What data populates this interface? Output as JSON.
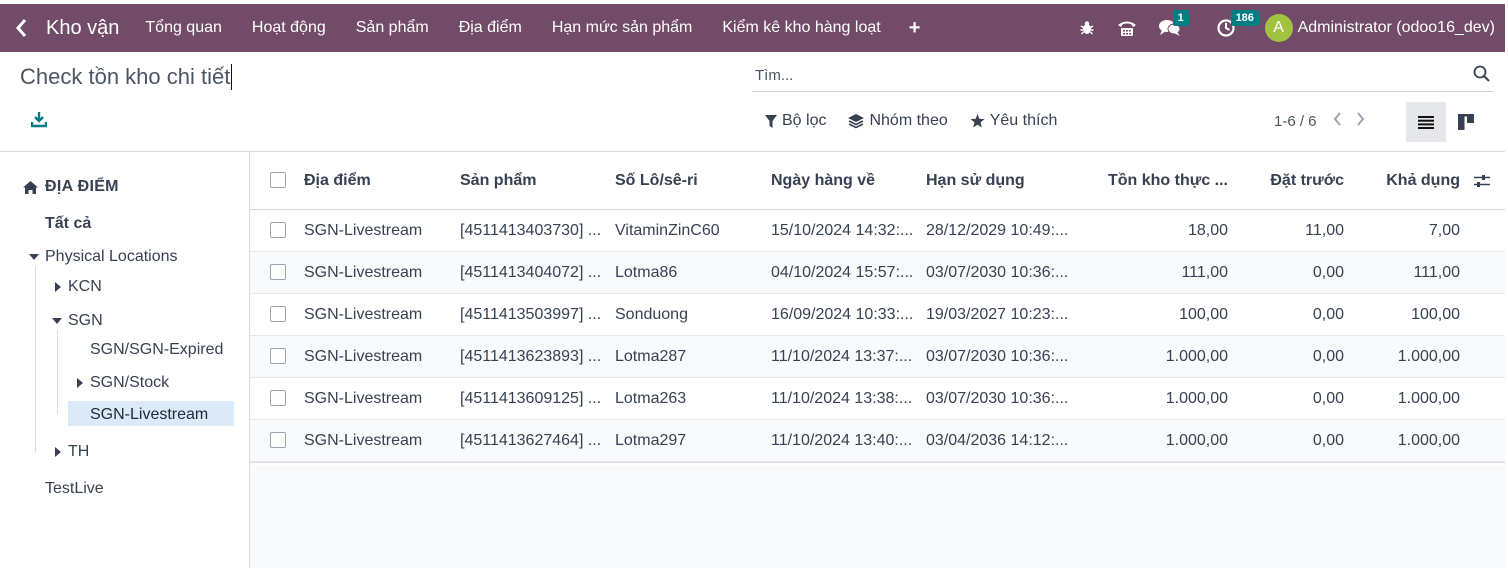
{
  "navbar": {
    "app_title": "Kho vận",
    "menu": [
      "Tổng quan",
      "Hoạt động",
      "Sản phẩm",
      "Địa điểm",
      "Hạn mức sản phẩm",
      "Kiểm kê kho hàng loạt"
    ],
    "messages_badge": "1",
    "activities_badge": "186",
    "avatar_letter": "A",
    "user_name": "Administrator (odoo16_dev)",
    "brand_color": "#714b67"
  },
  "control_panel": {
    "title": "Check tồn kho chi tiết",
    "search_placeholder": "Tìm...",
    "filter_label": "Bộ lọc",
    "group_label": "Nhóm theo",
    "favorite_label": "Yêu thích",
    "pager": "1-6 / 6"
  },
  "sidebar": {
    "heading": "ĐỊA ĐIỂM",
    "items": [
      "Tất cả",
      "Physical Locations",
      "KCN",
      "SGN",
      "SGN/SGN-Expired",
      "SGN/Stock",
      "SGN-Livestream",
      "TH",
      "TestLive"
    ]
  },
  "table": {
    "columns": [
      "Địa điểm",
      "Sản phẩm",
      "Số Lô/sê-ri",
      "Ngày hàng về",
      "Hạn sử dụng",
      "Tồn kho thực ...",
      "Đặt trước",
      "Khả dụng"
    ],
    "rows": [
      [
        "SGN-Livestream",
        "[4511413403730] ...",
        "VitaminZinC60",
        "15/10/2024 14:32:...",
        "28/12/2029 10:49:...",
        "18,00",
        "11,00",
        "7,00"
      ],
      [
        "SGN-Livestream",
        "[4511413404072] ...",
        "Lotma86",
        "04/10/2024 15:57:...",
        "03/07/2030 10:36:...",
        "111,00",
        "0,00",
        "111,00"
      ],
      [
        "SGN-Livestream",
        "[4511413503997] ...",
        "Sonduong",
        "16/09/2024 10:33:...",
        "19/03/2027 10:23:...",
        "100,00",
        "0,00",
        "100,00"
      ],
      [
        "SGN-Livestream",
        "[4511413623893] ...",
        "Lotma287",
        "11/10/2024 13:37:...",
        "03/07/2030 10:36:...",
        "1.000,00",
        "0,00",
        "1.000,00"
      ],
      [
        "SGN-Livestream",
        "[4511413609125] ...",
        "Lotma263",
        "11/10/2024 13:38:...",
        "03/07/2030 10:36:...",
        "1.000,00",
        "0,00",
        "1.000,00"
      ],
      [
        "SGN-Livestream",
        "[4511413627464] ...",
        "Lotma297",
        "11/10/2024 13:40:...",
        "03/04/2036 14:12:...",
        "1.000,00",
        "0,00",
        "1.000,00"
      ]
    ]
  }
}
